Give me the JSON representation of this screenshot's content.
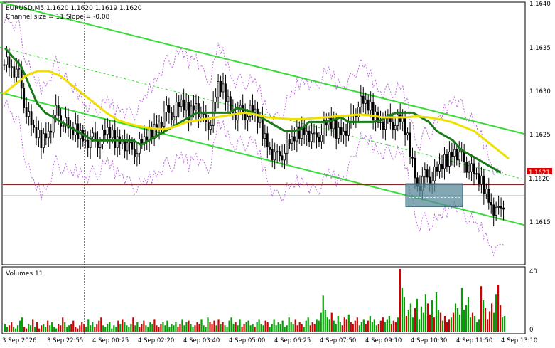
{
  "header": {
    "symbol_line": "EURUSD,M5  1.1620 1.1620 1.1619 1.1620",
    "indicator_line": "Channel size = 11 Slope = -0.08"
  },
  "volume_panel": {
    "label": "Volumes 11",
    "ticks": [
      "40",
      "0"
    ]
  },
  "price_axis": {
    "ticks": [
      "1.1640",
      "1.1635",
      "1.1630",
      "1.1625",
      "1.1620",
      "1.1615"
    ],
    "current_label": "1.1620",
    "level_label": "1.1621"
  },
  "time_axis": {
    "ticks": [
      "3 Sep 2026",
      "3 Sep 22:55",
      "4 Sep 00:25",
      "4 Sep 02:20",
      "4 Sep 03:40",
      "4 Sep 05:00",
      "4 Sep 06:25",
      "4 Sep 07:50",
      "4 Sep 09:10",
      "4 Sep 10:30",
      "4 Sep 11:50",
      "4 Sep 13:10"
    ]
  },
  "chart_data": {
    "type": "line",
    "symbol": "EURUSD",
    "timeframe": "M5",
    "ylim": [
      1.16125,
      1.1641
    ],
    "volume_ylim": [
      0,
      40
    ],
    "x_categories": [
      "3 Sep 2026",
      "3 Sep 22:55",
      "4 Sep 00:25",
      "4 Sep 02:20",
      "4 Sep 03:40",
      "4 Sep 05:00",
      "4 Sep 06:25",
      "4 Sep 07:50",
      "4 Sep 09:10",
      "4 Sep 10:30",
      "4 Sep 11:50",
      "4 Sep 13:10"
    ],
    "price_close": [
      1.1635,
      1.1634,
      1.1633,
      1.1629,
      1.1627,
      1.1626,
      1.1627,
      1.1629,
      1.1628,
      1.1627,
      1.1627,
      1.1626,
      1.1626,
      1.1626,
      1.1627,
      1.1626,
      1.1626,
      1.1625,
      1.1625,
      1.1626,
      1.1627,
      1.1628,
      1.1629,
      1.1629,
      1.163,
      1.1629,
      1.163,
      1.1628,
      1.1628,
      1.1632,
      1.1631,
      1.1629,
      1.1629,
      1.1629,
      1.1629,
      1.1627,
      1.1625,
      1.1624,
      1.1625,
      1.1626,
      1.1627,
      1.1627,
      1.1626,
      1.1627,
      1.1628,
      1.1627,
      1.1627,
      1.1628,
      1.163,
      1.163,
      1.1629,
      1.1628,
      1.1628,
      1.1628,
      1.1628,
      1.1625,
      1.1621,
      1.1622,
      1.1622,
      1.1623,
      1.1624,
      1.1625,
      1.1624,
      1.1623,
      1.1622,
      1.1621,
      1.1619,
      1.1618,
      1.162
    ],
    "ma_green": [
      1.1636,
      1.1635,
      1.1634,
      1.1632,
      1.163,
      1.1629,
      1.16285,
      1.1628,
      1.16275,
      1.1627,
      1.16265,
      1.1626,
      1.1626,
      1.1626,
      1.1626,
      1.1626,
      1.1626,
      1.16255,
      1.1626,
      1.16265,
      1.1627,
      1.16275,
      1.1628,
      1.16285,
      1.1629,
      1.1629,
      1.1629,
      1.1629,
      1.1629,
      1.16295,
      1.16293,
      1.1629,
      1.16285,
      1.1628,
      1.16275,
      1.1627,
      1.1627,
      1.16272,
      1.1628,
      1.1628,
      1.1628,
      1.16282,
      1.16285,
      1.1628,
      1.1628,
      1.1628,
      1.1628,
      1.16282,
      1.16287,
      1.1629,
      1.1629,
      1.1629,
      1.16285,
      1.1628,
      1.1627,
      1.16265,
      1.1626,
      1.1625,
      1.16245,
      1.1624,
      1.16235,
      1.1623,
      1.16225
    ],
    "ma_yellow": [
      1.1631,
      1.1632,
      1.1633,
      1.16335,
      1.16335,
      1.1633,
      1.1632,
      1.1631,
      1.163,
      1.1629,
      1.16282,
      1.16278,
      1.16275,
      1.16273,
      1.16272,
      1.16275,
      1.1628,
      1.16282,
      1.16284,
      1.16286,
      1.16288,
      1.1629,
      1.16288,
      1.16285,
      1.16284,
      1.16283,
      1.16283,
      1.16284,
      1.16285,
      1.16286,
      1.16287,
      1.16288,
      1.16287,
      1.16285,
      1.16285,
      1.16285,
      1.16286,
      1.16285,
      1.16283,
      1.1628,
      1.16275,
      1.1627,
      1.1626,
      1.1625,
      1.1624
    ],
    "ma_green_x": [
      3,
      13,
      23,
      33,
      43,
      53,
      63,
      73,
      83,
      93,
      103,
      113,
      123,
      133,
      143,
      153,
      163,
      173,
      183,
      193,
      203,
      213,
      223,
      233,
      243,
      253,
      263,
      273,
      283,
      293,
      303,
      313,
      323,
      333,
      343,
      353,
      363,
      373,
      383,
      393,
      403,
      413,
      423,
      433,
      443,
      453,
      463,
      473,
      483,
      493,
      503,
      513,
      523,
      533,
      543,
      553,
      563,
      573,
      583,
      593,
      603,
      613,
      623
    ],
    "channel_upper": {
      "x": [
        0,
        738
      ],
      "y": [
        1.1641,
        1.16267
      ]
    },
    "channel_lower": {
      "x": [
        0,
        738
      ],
      "y": [
        1.16312,
        1.16168
      ]
    },
    "horizontal_level": 1.16212,
    "zone": {
      "y_top": 1.16213,
      "y_bottom": 1.16188
    },
    "volumes": [
      5,
      3,
      4,
      6,
      3,
      2,
      4,
      7,
      9,
      3,
      2,
      5,
      4,
      8,
      3,
      6,
      2,
      4,
      5,
      3,
      7,
      4,
      6,
      3,
      2,
      5,
      4,
      9,
      6,
      3,
      4,
      5,
      7,
      3,
      2,
      4,
      6,
      5,
      3,
      8,
      4,
      6,
      3,
      5,
      7,
      9,
      4,
      3,
      5,
      6,
      2,
      4,
      3,
      7,
      5,
      8,
      6,
      4,
      3,
      5,
      9,
      4,
      6,
      3,
      5,
      7,
      4,
      3,
      6,
      5,
      8,
      4,
      3,
      5,
      6,
      4,
      7,
      3,
      5,
      4,
      6,
      3,
      5,
      8,
      4,
      6,
      7,
      5,
      3,
      4,
      6,
      5,
      8,
      4,
      3,
      9,
      6,
      5,
      7,
      4,
      8,
      5,
      6,
      4,
      3,
      7,
      9,
      5,
      6,
      4,
      8,
      3,
      5,
      6,
      7,
      4,
      5,
      3,
      6,
      8,
      5,
      4,
      7,
      6,
      3,
      5,
      8,
      4,
      6,
      5,
      7,
      3,
      4,
      9,
      6,
      5,
      8,
      4,
      6,
      5,
      3,
      7,
      9,
      4,
      6,
      5,
      8,
      7,
      12,
      23,
      14,
      9,
      8,
      12,
      7,
      5,
      10,
      6,
      4,
      9,
      8,
      11,
      6,
      5,
      7,
      9,
      4,
      6,
      8,
      5,
      7,
      10,
      6,
      8,
      4,
      5,
      7,
      9,
      6,
      8,
      10,
      5,
      7,
      6,
      9,
      40,
      28,
      22,
      10,
      14,
      18,
      9,
      15,
      21,
      8,
      16,
      12,
      24,
      18,
      11,
      20,
      9,
      25,
      14,
      12,
      7,
      10,
      6,
      8,
      9,
      12,
      18,
      15,
      11,
      28,
      14,
      17,
      22,
      9,
      12,
      10,
      6,
      8,
      29,
      20,
      15,
      8,
      13,
      18,
      12,
      24,
      30,
      17,
      9,
      10
    ]
  },
  "colors": {
    "bull": "#00a000",
    "bear": "#d00000",
    "candle": "#000000",
    "ma_green": "#1a7a1a",
    "ma_yellow": "#f0e000",
    "channel": "#33dd33",
    "level": "#e00000",
    "bands": "#bb66dd",
    "zone": "#5a8a9a"
  }
}
